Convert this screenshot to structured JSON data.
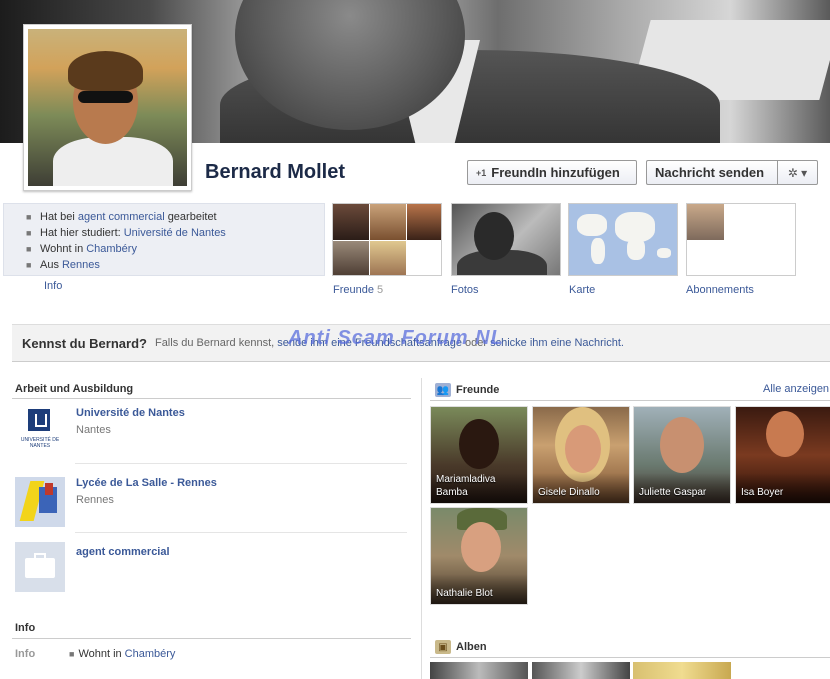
{
  "profile": {
    "name": "Bernard Mollet"
  },
  "actions": {
    "add_friend_icon": "+1",
    "add_friend_label": "FreundIn hinzufügen",
    "message_label": "Nachricht senden",
    "gear_icon": "gear-icon",
    "gear_glyph": "✲ ▾"
  },
  "intro": {
    "items": [
      {
        "icon": "briefcase-icon",
        "glyph": "■",
        "prefix": "Hat bei",
        "link": "agent commercial",
        "suffix": "gearbeitet"
      },
      {
        "icon": "school-icon",
        "glyph": "■",
        "prefix": "Hat hier studiert:",
        "link": "Université de Nantes",
        "suffix": ""
      },
      {
        "icon": "house-icon",
        "glyph": "■",
        "prefix": "Wohnt in",
        "link": "Chambéry",
        "suffix": ""
      },
      {
        "icon": "home-icon",
        "glyph": "■",
        "prefix": "Aus",
        "link": "Rennes",
        "suffix": ""
      }
    ],
    "info_label": "Info"
  },
  "tiles": {
    "friends_label": "Freunde",
    "friends_count": "5",
    "photos_label": "Fotos",
    "map_label": "Karte",
    "subs_label": "Abonnements"
  },
  "watermark": "Anti Scam Forum NL",
  "know": {
    "question": "Kennst du Bernard?",
    "text_before": "Falls du Bernard kennst,",
    "link1": "sende ihm eine Freundschaftsanfrage",
    "text_mid": "oder",
    "link2": "schicke ihm eine Nachricht.",
    "text_after": ""
  },
  "work": {
    "title": "Arbeit und Ausbildung",
    "items": [
      {
        "name": "Université de Nantes",
        "sub": "Nantes",
        "logo_caption": "UNIVERSITÉ DE NANTES"
      },
      {
        "name": "Lycée de La Salle - Rennes",
        "sub": "Rennes"
      },
      {
        "name": "agent commercial",
        "sub": ""
      }
    ]
  },
  "info": {
    "title": "Info",
    "row_label": "Info",
    "lives_prefix": "Wohnt in",
    "lives_link": "Chambéry",
    "icon": "house-icon"
  },
  "friends": {
    "title": "Freunde",
    "see_all": "Alle anzeigen",
    "icon": "people-icon",
    "icon_glyph": "👥",
    "items": [
      {
        "name": "Mariamladiva Bamba"
      },
      {
        "name": "Gisele Dinallo"
      },
      {
        "name": "Juliette Gaspar"
      },
      {
        "name": "Isa Boyer"
      },
      {
        "name": "Nathalie Blot"
      }
    ]
  },
  "albums": {
    "title": "Alben",
    "icon": "album-icon",
    "icon_glyph": "▣"
  },
  "colors": {
    "link": "#3b5998",
    "name": "#1c2a47",
    "intro_bg": "#edeff4",
    "watermark": "#5a6edc"
  }
}
